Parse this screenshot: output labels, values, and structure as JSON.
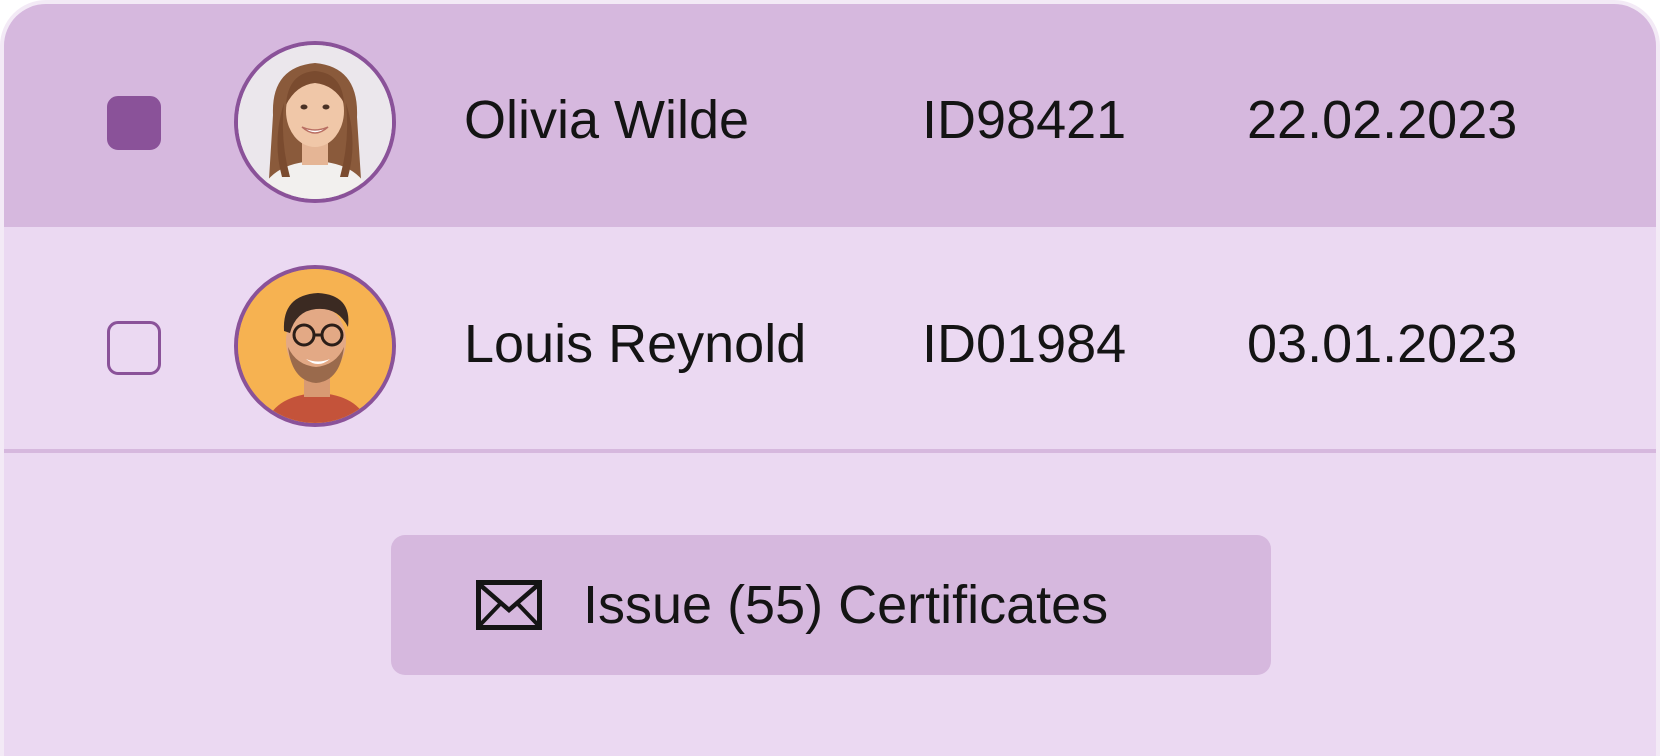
{
  "rows": [
    {
      "selected": true,
      "name": "Olivia Wilde",
      "id": "ID98421",
      "date": "22.02.2023",
      "avatar_icon": "portrait-woman-icon"
    },
    {
      "selected": false,
      "name": "Louis Reynold",
      "id": "ID01984",
      "date": "03.01.2023",
      "avatar_icon": "portrait-man-icon"
    }
  ],
  "action": {
    "label": "Issue (55) Certificates",
    "icon": "envelope-icon"
  },
  "colors": {
    "card_background": "#ebd9f2",
    "selected_row": "#d6b8de",
    "accent": "#8a5299",
    "button_background": "#d6b8de",
    "text": "#141414"
  }
}
